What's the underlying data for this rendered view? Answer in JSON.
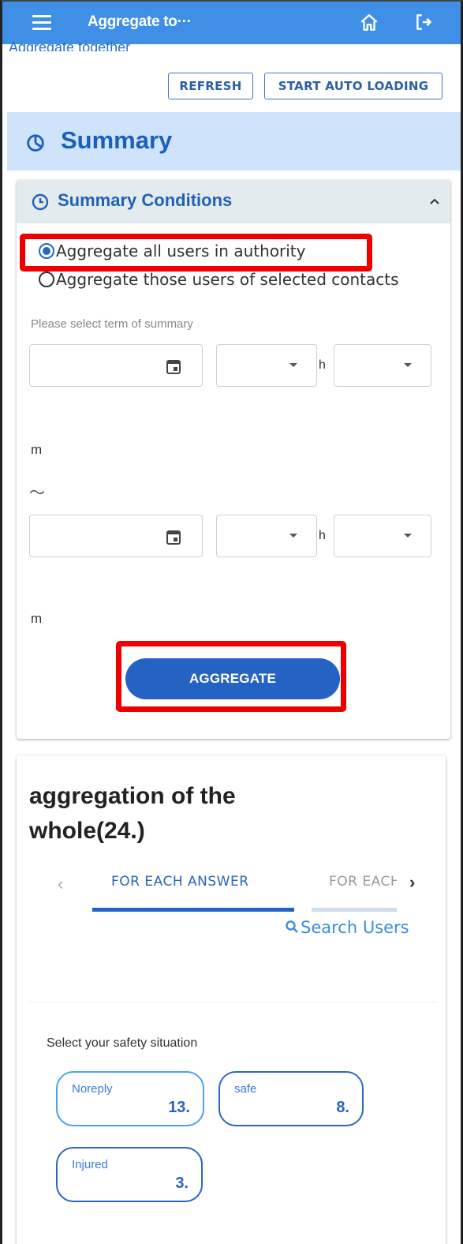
{
  "appbar": {
    "title": "Aggregate to···",
    "menu_icon": "menu-icon",
    "home_icon": "home-icon",
    "logout_icon": "logout-icon",
    "color": "#3f8fe6"
  },
  "subtitle": "Aggregate together",
  "toolbar": {
    "refresh_label": "REFRESH",
    "auto_label": "START AUTO LOADING"
  },
  "summary": {
    "title": "Summary",
    "icon": "pie-chart-icon"
  },
  "conditions": {
    "title": "Summary Conditions",
    "icon": "clock-icon",
    "collapse_icon": "chevron-up-icon",
    "radio_all": "Aggregate all users in authority",
    "radio_selected": "Aggregate those users of selected contacts",
    "selected_option": "all",
    "term_hint": "Please select term of summary",
    "hour_unit": "h",
    "minute_unit": "m",
    "range_sep": "～",
    "start": {
      "date": "",
      "hour": "",
      "minute": ""
    },
    "end": {
      "date": "",
      "hour": "",
      "minute": ""
    },
    "aggregate_label": "AGGREGATE"
  },
  "result": {
    "title": "aggregation of the whole(24.)",
    "tabs": [
      {
        "label": "FOR EACH ANSWER",
        "active": true
      },
      {
        "label": "FOR EACH",
        "active": false
      }
    ],
    "search_label": "Search Users",
    "question": "Select your safety situation",
    "answers": [
      {
        "label": "Noreply",
        "count": "13."
      },
      {
        "label": "safe",
        "count": "8."
      },
      {
        "label": "Injured",
        "count": "3."
      }
    ]
  },
  "colors": {
    "accent": "#2463c4",
    "highlight": "#ee0000",
    "summary_bg": "#cfe3fa"
  }
}
